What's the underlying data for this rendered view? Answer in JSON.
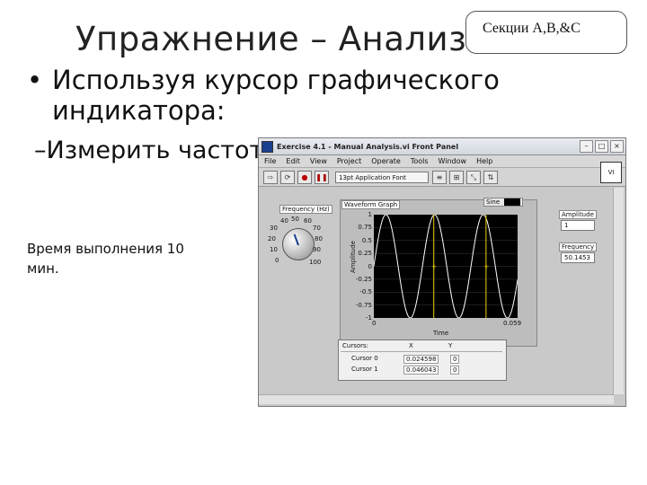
{
  "slide": {
    "title": "Упражнение – Анализ сигнала",
    "callout": "Секции A,B,&C",
    "bullet1_marker": "•",
    "bullet1": "Используя курсор графического индикатора:",
    "bullet2": "–Измерить частоту",
    "note": "Время выполнения 10 мин."
  },
  "window": {
    "title": "Exercise 4.1 - Manual Analysis.vi Front Panel",
    "buttons": {
      "minimize": "–",
      "maximize": "□",
      "close": "×"
    },
    "menu": [
      "File",
      "Edit",
      "View",
      "Project",
      "Operate",
      "Tools",
      "Window",
      "Help"
    ],
    "toolbar": {
      "run": "⇨",
      "run_continuous": "⟳",
      "abort": "●",
      "pause": "❚❚",
      "font": "13pt Application Font",
      "align": "≡",
      "distribute": "⊞",
      "resize": "⤡",
      "reorder": "⇅",
      "vi_icon": "VI"
    },
    "knob": {
      "label": "Frequency (Hz)",
      "ticks": [
        "0",
        "10",
        "20",
        "30",
        "40",
        "50",
        "60",
        "70",
        "80",
        "90",
        "100"
      ]
    },
    "graph": {
      "label": "Waveform Graph",
      "plot_legend": "Sine",
      "ylabel": "Amplitude",
      "xlabel": "Time",
      "y_ticks": [
        "1",
        "0.75",
        "0.5",
        "0.25",
        "0",
        "-0.25",
        "-0.5",
        "-0.75",
        "-1"
      ],
      "x_ticks": [
        "0",
        "0.059"
      ]
    },
    "cursors": {
      "headers": [
        "Cursors:",
        "X",
        "Y"
      ],
      "rows": [
        {
          "name": "Cursor 0",
          "x": "0.024598",
          "y": "0"
        },
        {
          "name": "Cursor 1",
          "x": "0.046043",
          "y": "0"
        }
      ]
    },
    "amplitude": {
      "label": "Amplitude",
      "value": "1"
    },
    "frequency": {
      "label": "Frequency",
      "value": "50.1453"
    }
  },
  "chart_data": {
    "type": "line",
    "series": [
      {
        "name": "Sine",
        "frequency_hz": 50.1453,
        "amplitude": 1
      }
    ],
    "x_range": [
      0,
      0.059
    ],
    "ylim": [
      -1,
      1
    ],
    "cursors_x": [
      0.024598,
      0.046043
    ],
    "grid": true,
    "color": "#ffffff",
    "background": "#000000"
  }
}
